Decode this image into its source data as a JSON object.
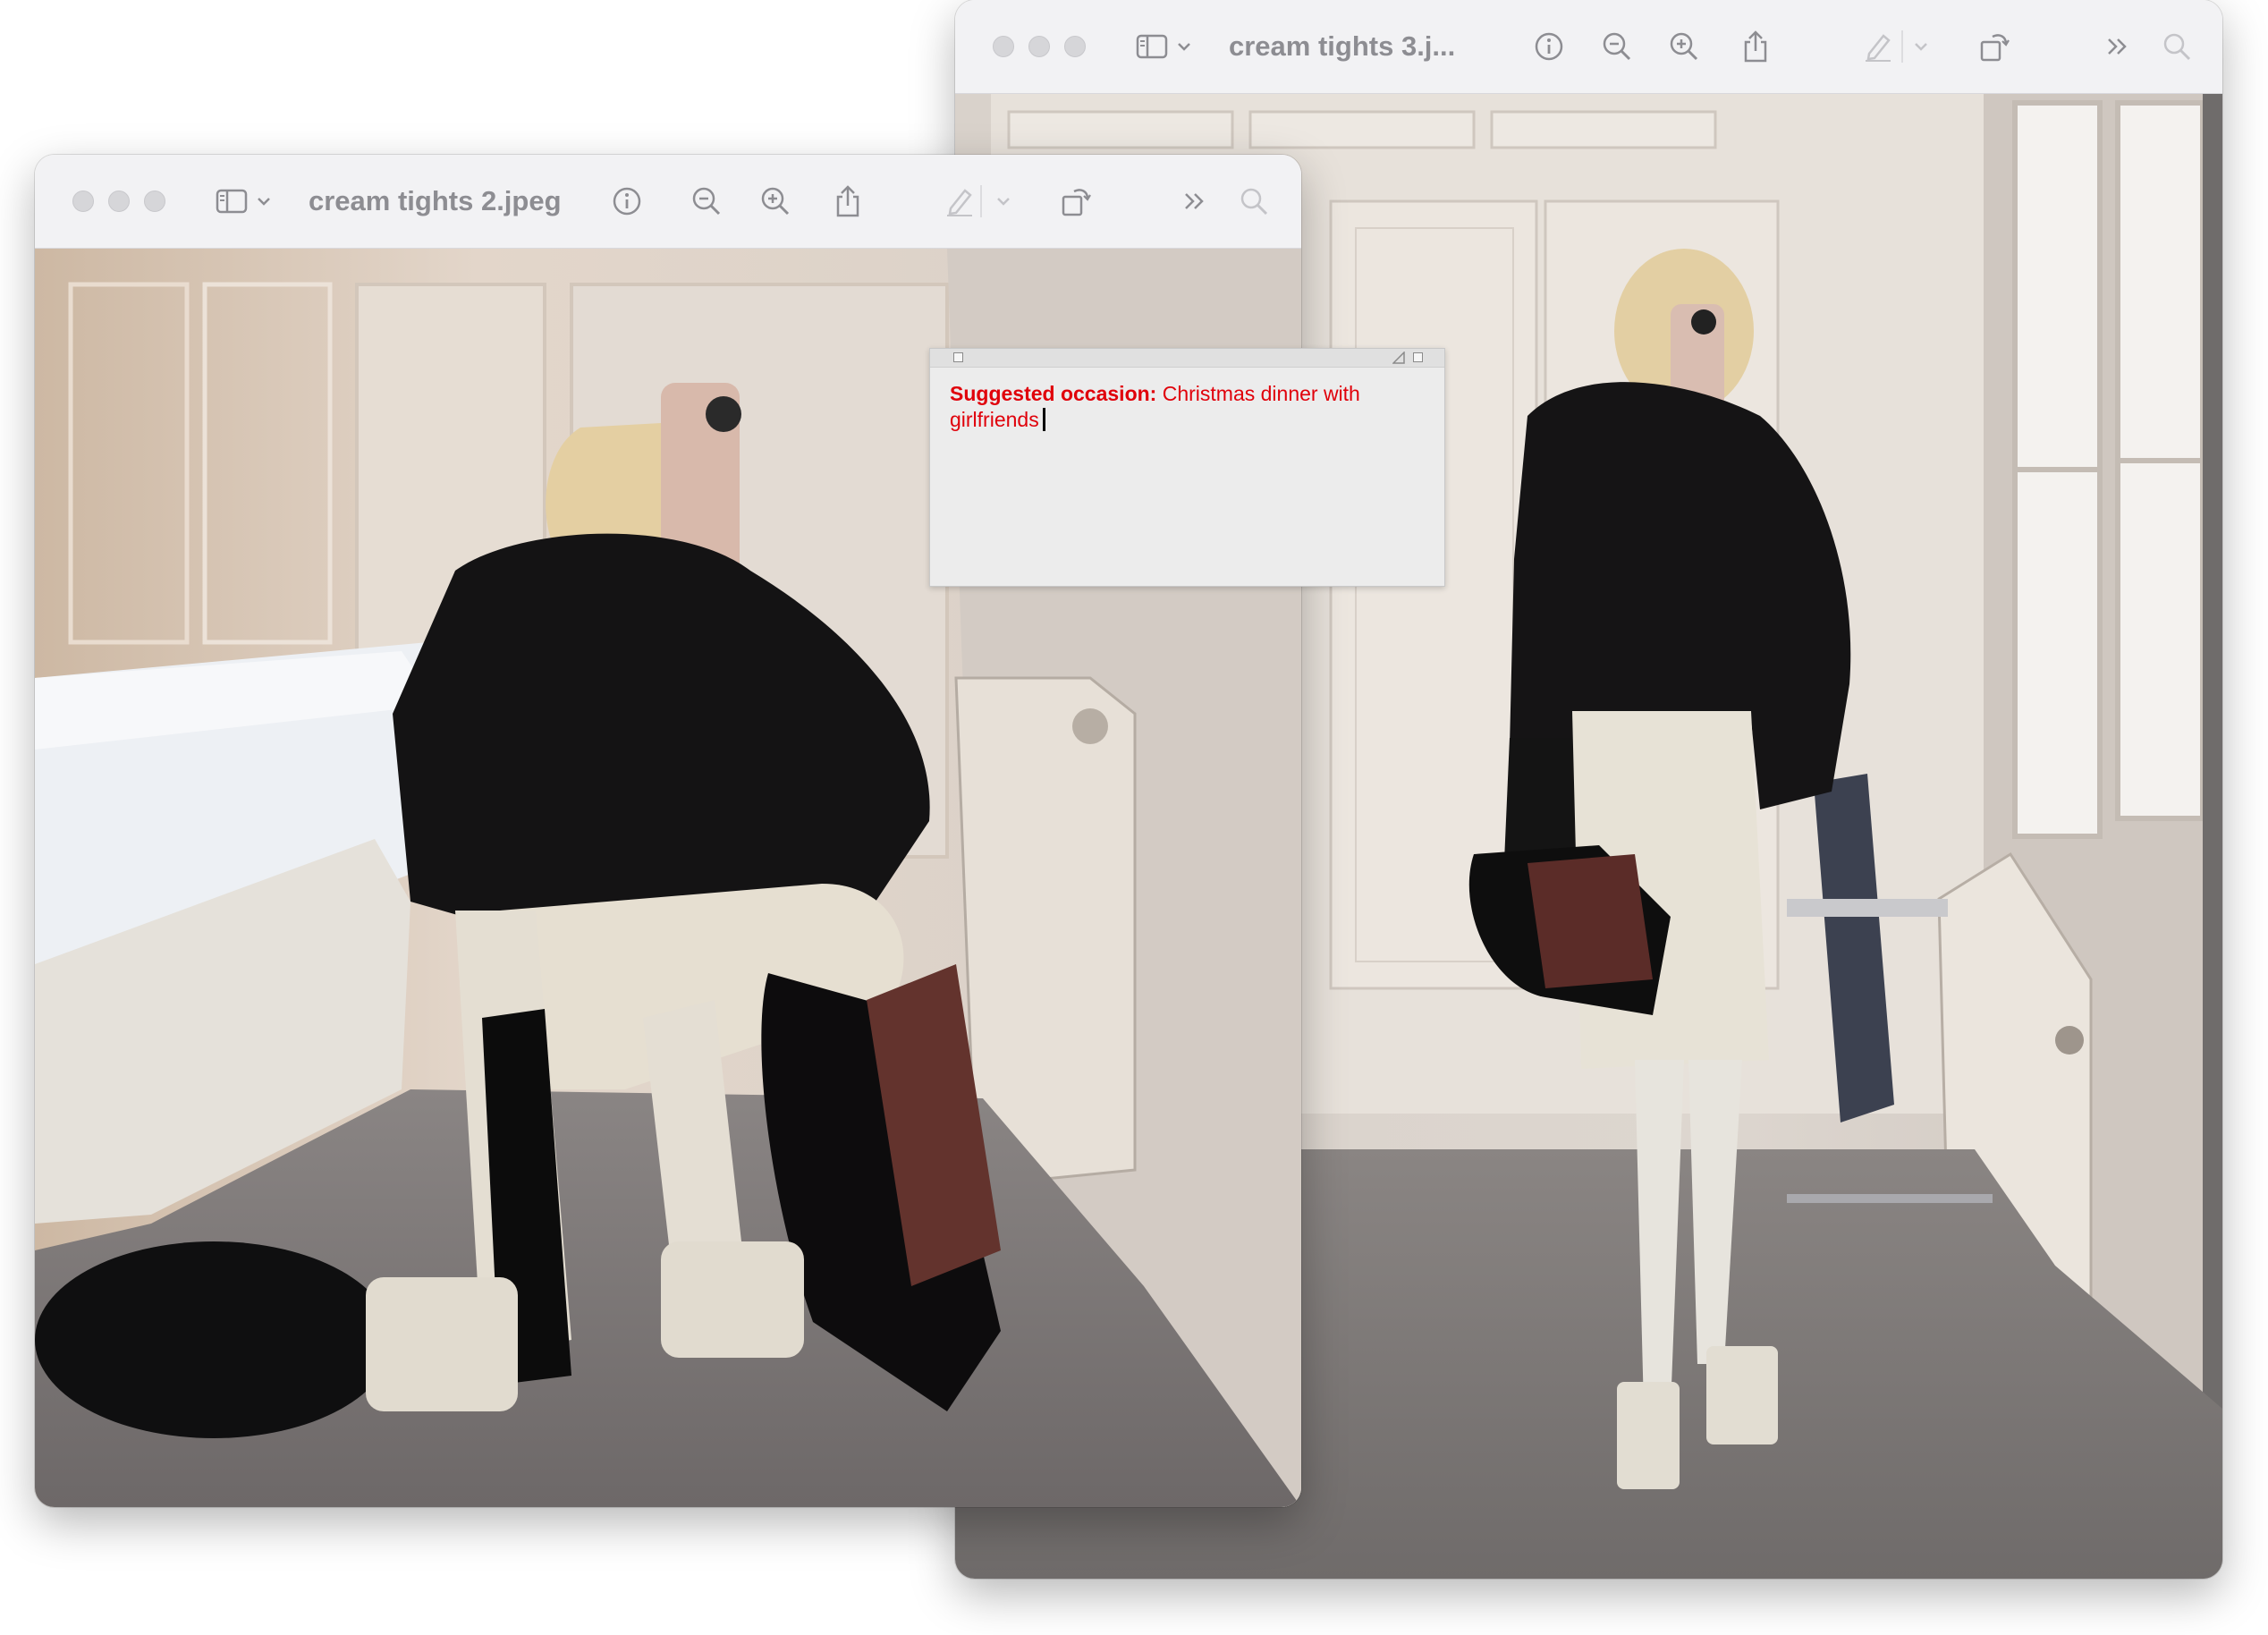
{
  "windows": {
    "back": {
      "title": "cream tights 3.j...",
      "photo_description_icon": "photo-outfit-standing"
    },
    "front": {
      "title": "cream tights 2.jpeg",
      "photo_description_icon": "photo-outfit-crouching"
    }
  },
  "toolbar_icons": [
    "sidebar-icon",
    "chevron-down-icon",
    "info-icon",
    "zoom-out-icon",
    "zoom-in-icon",
    "share-icon",
    "markup-icon",
    "chevron-down-icon",
    "rotate-icon",
    "more-icon",
    "search-icon"
  ],
  "note": {
    "label": "Suggested occasion:",
    "text": "Christmas dinner with girlfriends"
  },
  "colors": {
    "note_text": "#e0000a",
    "toolbar_bg": "#f2f2f4",
    "toolbar_icon": "#8d8d92"
  }
}
